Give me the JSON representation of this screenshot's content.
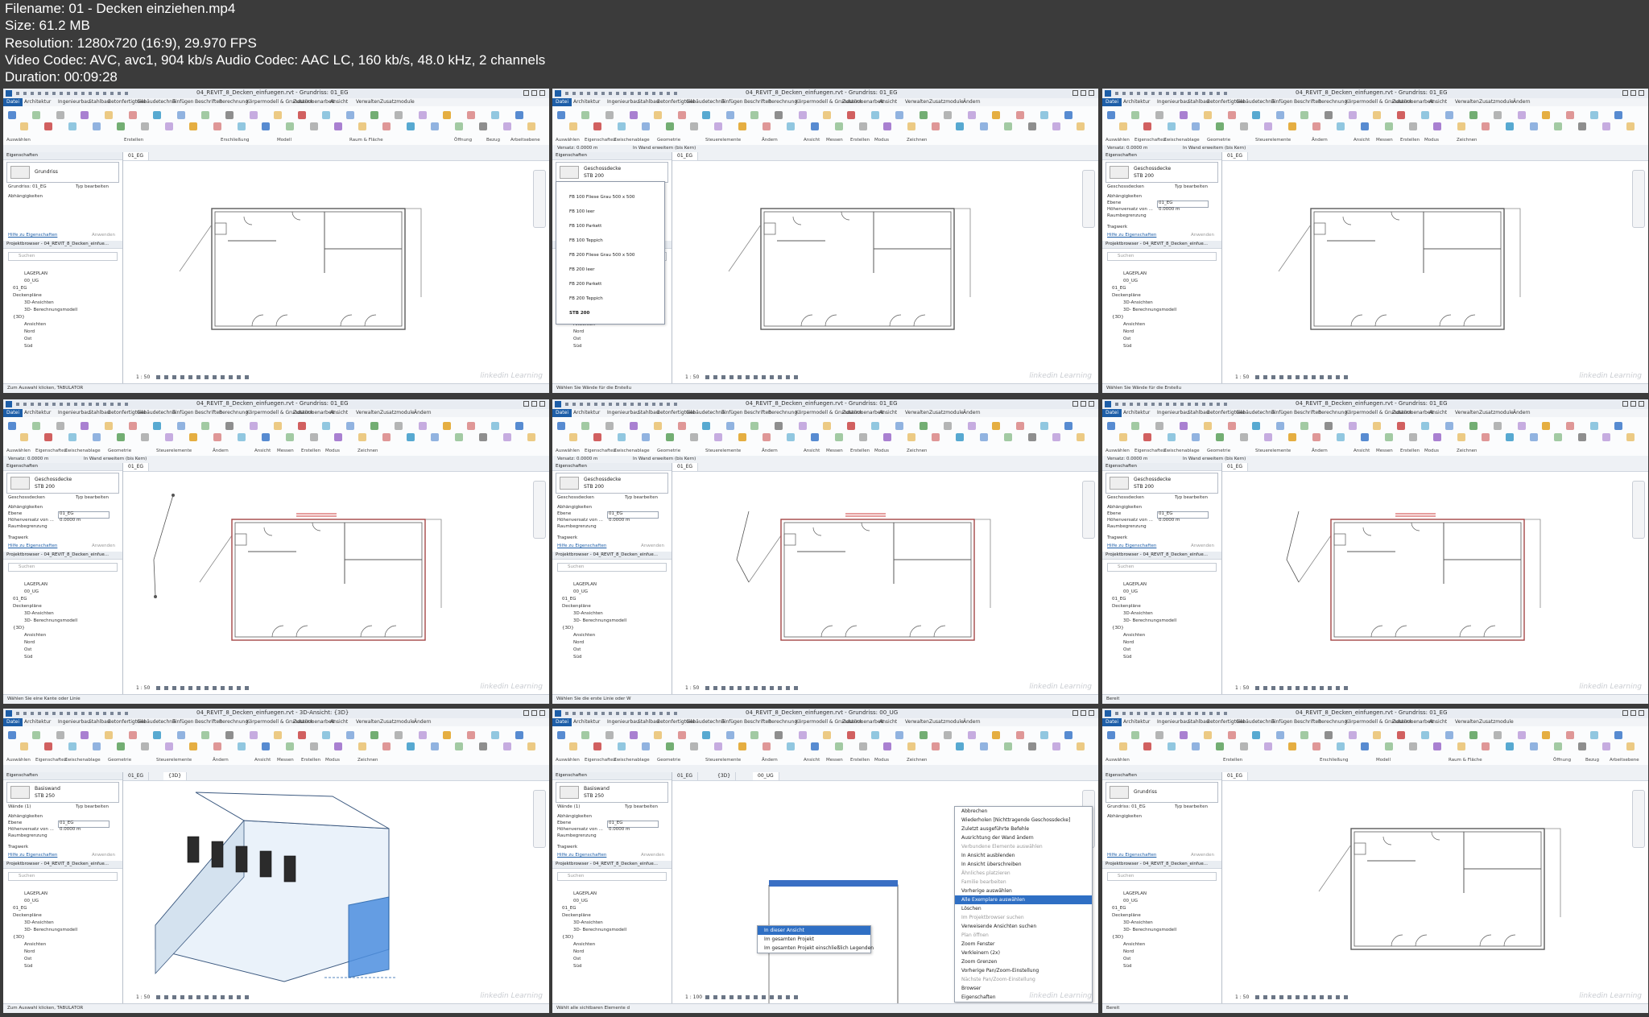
{
  "header": {
    "filename": "Filename: 01 - Decken einziehen.mp4",
    "size": "Size: 61.2 MB",
    "resolution": "Resolution: 1280x720 (16:9), 29.970 FPS",
    "codec": "Video Codec: AVC, avc1, 904 kb/s Audio Codec: AAC LC, 160 kb/s, 48.0 kHz, 2 channels",
    "duration": "Duration: 00:09:28"
  },
  "app": {
    "title_grundriss": "04_REVIT_8_Decken_einfuegen.rvt - Grundriss: 01_EG",
    "title_3d": "04_REVIT_8_Decken_einfuegen.rvt - 3D-Ansicht: {3D}",
    "title_ug": "04_REVIT_8_Decken_einfuegen.rvt - Grundriss: 00_UG",
    "menu": [
      "Datei",
      "Architektur",
      "Ingenieurbau",
      "Stahlbau",
      "Betonfertigteile",
      "Gebäudetechnik",
      "Einfügen",
      "Beschriften",
      "Berechnung",
      "Körpermodell & Grundstück",
      "Zusammenarbeit",
      "Ansicht",
      "Verwalten",
      "Zusatzmodule",
      "Ändern"
    ],
    "ribbon_groups_arch": [
      "Auswählen",
      "Erstellen",
      "Erschließung",
      "Modell",
      "Raum & Fläche",
      "Öffnung",
      "Bezug",
      "Arbeitsebene"
    ],
    "ribbon_groups_edit": [
      "Auswählen",
      "Eigenschaften",
      "Zwischenablage",
      "Geometrie",
      "Steuerelemente",
      "Ändern",
      "Ansicht",
      "Messen",
      "Erstellen",
      "Modus",
      "Zeichnen"
    ]
  },
  "panels": {
    "properties": "Eigenschaften",
    "edit_type": "Typ bearbeiten",
    "floor_plan_type": "Grundriss",
    "floor_plan_filter": "Grundriss: 01_EG",
    "floor_type": "Geschossdecke",
    "floor_sub": "STB 200",
    "floors_filter": "Geschossdecken",
    "wall_type": "Basiswand",
    "wall_sub": "STB 250",
    "walls_filter": "Wände (1)",
    "constraints": "Abhängigkeiten",
    "level": "Ebene",
    "level_val": "01_EG",
    "offset": "Höhenversatz von ...",
    "offset_val": "0.0000 m",
    "room_bounding": "Raumbegrenzung",
    "structure": "Tragwerk",
    "help_link": "Hilfe zu Eigenschaften",
    "apply": "Anwenden",
    "browser": "Projektbrowser - 04_REVIT_8_Decken_einfue...",
    "search": "Suchen",
    "tree_plan": [
      "LAGEPLAN",
      "00_UG",
      "01_EG",
      "Deckenpläne",
      "3D-Ansichten",
      "3D- Berechnungsmodell",
      "{3D}",
      "Ansichten",
      "Nord",
      "Ost",
      "Süd"
    ],
    "options_offset": "Versatz:",
    "options_offset_val": "0.0000 m",
    "options_extend": "In Wand erweitern (bis Kern)"
  },
  "floor_types": [
    "FB 100 Fliese Grau 500 x 500",
    "FB 100 leer",
    "FB 100 Parkett",
    "FB 100 Teppich",
    "FB 200 Fliese Grau 500 x 500",
    "FB 200 leer",
    "FB 200 Parkett",
    "FB 200 Teppich",
    "STB 200"
  ],
  "views": {
    "tab_eg": "01_EG",
    "tab_3d": "{3D}",
    "tab_ug": "00_UG",
    "scale": "1 : 50",
    "scale_ug": "1 : 100"
  },
  "status": {
    "t1": "Zum Auswahl klicken, TABULATOR",
    "t2": "Wählen Sie Wände für die Erstellu",
    "t3": "Wählen Sie Wände für die Erstellu",
    "t4": "Wählen Sie eine Kante oder Linie",
    "t5": "Wählen Sie die erste Linie oder W",
    "t6": "Bereit",
    "t7": "Zum Auswahl klicken, TABULATOR",
    "t8": "Wählt alle sichtbaren Elemente d",
    "t9": "Bereit"
  },
  "context": {
    "submenu": [
      "In dieser Ansicht",
      "Im gesamten Projekt",
      "Im gesamten Projekt einschließlich Legenden"
    ],
    "main": [
      "Abbrechen",
      "Wiederholen [Nichttragende Geschossdecke]",
      "Zuletzt ausgeführte Befehle",
      "Ausrichtung der Wand ändern",
      "Verbundene Elemente auswählen",
      "In Ansicht ausblenden",
      "In Ansicht überschreiben",
      "Ähnliches platzieren",
      "Familie bearbeiten",
      "Vorherige auswählen",
      "Alle Exemplare auswählen",
      "Löschen",
      "Im Projektbrowser suchen",
      "Verweisende Ansichten suchen",
      "Plan öffnen",
      "Zoom Fenster",
      "Verkleinern (2x)",
      "Zoom Grenzen",
      "Vorherige Pan/Zoom-Einstellung",
      "Nächste Pan/Zoom-Einstellung",
      "Browser",
      "Eigenschaften"
    ]
  },
  "watermark": "linkedin Learning",
  "colors": {
    "accent": "#1d5ea8",
    "sketch": "#cc3b3b",
    "wall": "#5a5a5a"
  }
}
